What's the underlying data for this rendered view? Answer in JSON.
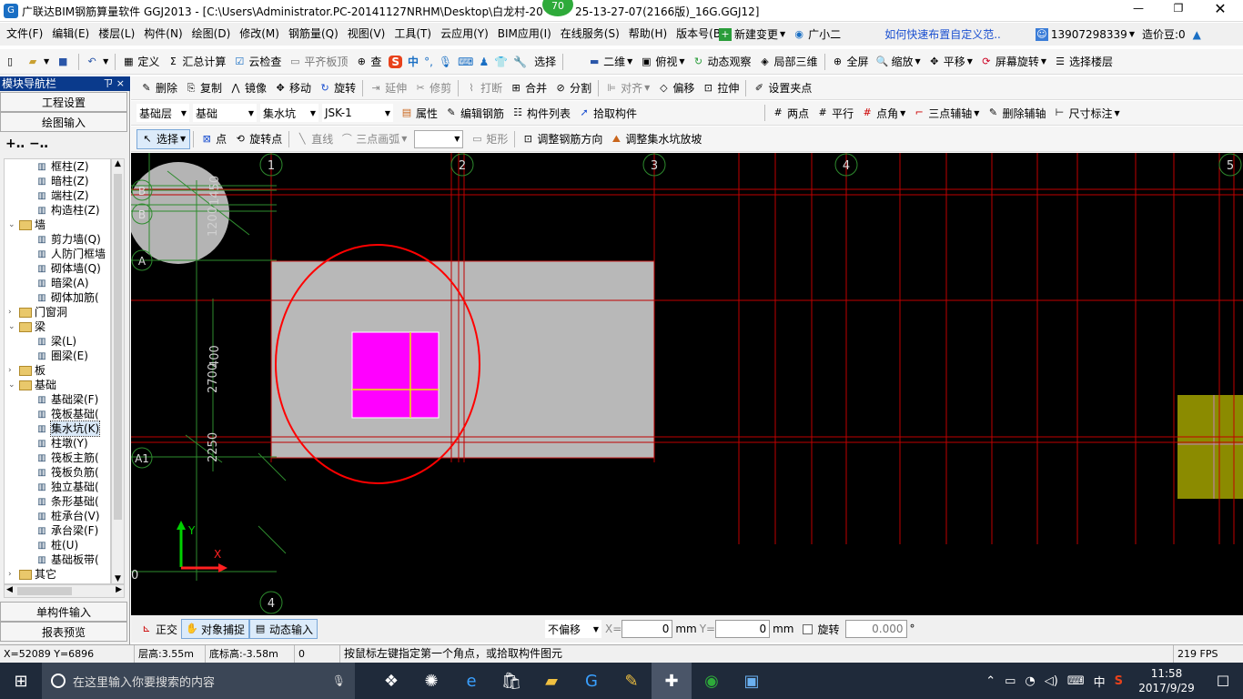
{
  "window": {
    "title": "广联达BIM钢筋算量软件 GGJ2013 - [C:\\Users\\Administrator.PC-20141127NRHM\\Desktop\\白龙村-20",
    "title_tail": "25-13-27-07(2166版)_16G.GGJ12]",
    "badge": "70"
  },
  "menu": [
    "文件(F)",
    "编辑(E)",
    "楼层(L)",
    "构件(N)",
    "绘图(D)",
    "修改(M)",
    "钢筋量(Q)",
    "视图(V)",
    "工具(T)",
    "云应用(Y)",
    "BIM应用(I)",
    "在线服务(S)",
    "帮助(H)",
    "版本号(B)"
  ],
  "menu_right": {
    "new_change": "新建变更",
    "assistant": "广小二",
    "tip": "如何快速布置自定义范..",
    "phone": "13907298339",
    "cost": "造价豆:0"
  },
  "toolbar1": {
    "define": "定义",
    "sum": "汇总计算",
    "cloud_check": "云检查",
    "flat_top": "平齐板顶",
    "find": "查",
    "select": "选择",
    "view2d": "二维",
    "top_view": "俯视",
    "dynamic": "动态观察",
    "local3d": "局部三维",
    "full": "全屏",
    "zoom": "缩放",
    "pan": "平移",
    "rotate": "屏幕旋转",
    "floor": "选择楼层",
    "ime": "中"
  },
  "toolbar2": {
    "delete": "删除",
    "copy": "复制",
    "mirror": "镜像",
    "move": "移动",
    "rotate": "旋转",
    "extend": "延伸",
    "trim": "修剪",
    "break": "打断",
    "merge": "合并",
    "split": "分割",
    "align": "对齐",
    "offset": "偏移",
    "stretch": "拉伸",
    "set_grip": "设置夹点"
  },
  "toolbar3": {
    "layer": "基础层",
    "type": "基础",
    "category": "集水坑",
    "item": "JSK-1",
    "props": "属性",
    "edit_rebar": "编辑钢筋",
    "list": "构件列表",
    "pick": "拾取构件",
    "two_point": "两点",
    "parallel": "平行",
    "point_angle": "点角",
    "three_point": "三点辅轴",
    "del_axis": "删除辅轴",
    "dim": "尺寸标注"
  },
  "toolbar4": {
    "select": "选择",
    "point": "点",
    "rot_point": "旋转点",
    "line": "直线",
    "arc": "三点画弧",
    "rect": "矩形",
    "adjust_rebar": "调整钢筋方向",
    "adjust_slope": "调整集水坑放坡"
  },
  "sidebar": {
    "header": "模块导航栏",
    "pin": "ㄗ ×",
    "project": "工程设置",
    "draw": "绘图输入",
    "single": "单构件输入",
    "report": "报表预览",
    "tree": [
      {
        "label": "框柱(Z)",
        "level": 2,
        "kind": "item"
      },
      {
        "label": "暗柱(Z)",
        "level": 2,
        "kind": "item"
      },
      {
        "label": "端柱(Z)",
        "level": 2,
        "kind": "item"
      },
      {
        "label": "构造柱(Z)",
        "level": 2,
        "kind": "item"
      },
      {
        "label": "墙",
        "level": 1,
        "kind": "folder",
        "open": true
      },
      {
        "label": "剪力墙(Q)",
        "level": 2,
        "kind": "item"
      },
      {
        "label": "人防门框墙",
        "level": 2,
        "kind": "item"
      },
      {
        "label": "砌体墙(Q)",
        "level": 2,
        "kind": "item"
      },
      {
        "label": "暗梁(A)",
        "level": 2,
        "kind": "item"
      },
      {
        "label": "砌体加筋(",
        "level": 2,
        "kind": "item"
      },
      {
        "label": "门窗洞",
        "level": 1,
        "kind": "folder",
        "open": false
      },
      {
        "label": "梁",
        "level": 1,
        "kind": "folder",
        "open": true
      },
      {
        "label": "梁(L)",
        "level": 2,
        "kind": "item"
      },
      {
        "label": "圈梁(E)",
        "level": 2,
        "kind": "item"
      },
      {
        "label": "板",
        "level": 1,
        "kind": "folder",
        "open": false
      },
      {
        "label": "基础",
        "level": 1,
        "kind": "folder",
        "open": true
      },
      {
        "label": "基础梁(F)",
        "level": 2,
        "kind": "item"
      },
      {
        "label": "筏板基础(",
        "level": 2,
        "kind": "item"
      },
      {
        "label": "集水坑(K)",
        "level": 2,
        "kind": "item",
        "selected": true
      },
      {
        "label": "柱墩(Y)",
        "level": 2,
        "kind": "item"
      },
      {
        "label": "筏板主筋(",
        "level": 2,
        "kind": "item"
      },
      {
        "label": "筏板负筋(",
        "level": 2,
        "kind": "item"
      },
      {
        "label": "独立基础(",
        "level": 2,
        "kind": "item"
      },
      {
        "label": "条形基础(",
        "level": 2,
        "kind": "item"
      },
      {
        "label": "桩承台(V)",
        "level": 2,
        "kind": "item"
      },
      {
        "label": "承台梁(F)",
        "level": 2,
        "kind": "item"
      },
      {
        "label": "桩(U)",
        "level": 2,
        "kind": "item"
      },
      {
        "label": "基础板带(",
        "level": 2,
        "kind": "item"
      },
      {
        "label": "其它",
        "level": 1,
        "kind": "folder",
        "open": false
      }
    ]
  },
  "canvas": {
    "axes_top": [
      "1",
      "2",
      "3",
      "4",
      "5"
    ],
    "axes_left": [
      "B",
      "B",
      "A",
      "A1"
    ],
    "axis_bottom": "4",
    "dims": [
      "1200",
      "1450",
      "2700",
      "400",
      "2250"
    ],
    "zero": "0",
    "ucs_y": "Y",
    "ucs_x": "X",
    "colors": {
      "grid": "#c00000",
      "slab": "#b8b8b8",
      "pit": "#ff00ff",
      "highlight": "#ff0000",
      "axis_green": "#2e8b2e",
      "olive": "#8b8b00"
    }
  },
  "bottom": {
    "ortho": "正交",
    "snap": "对象捕捉",
    "dyn": "动态输入",
    "offset": "不偏移",
    "x_label": "X=",
    "x_val": "0",
    "mm1": "mm",
    "y_label": "Y=",
    "y_val": "0",
    "mm2": "mm",
    "rotate": "旋转",
    "rot_val": "0.000",
    "deg": "°"
  },
  "status": {
    "coords": "X=52089 Y=6896",
    "floor_h": "层高:3.55m",
    "bottom_h": "底标高:-3.58m",
    "zero": "0",
    "hint": "按鼠标左键指定第一个角点，或拾取构件图元",
    "fps": "219 FPS"
  },
  "taskbar": {
    "search": "在这里输入你要搜索的内容",
    "time": "11:58",
    "date": "2017/9/29",
    "ime": "中"
  }
}
